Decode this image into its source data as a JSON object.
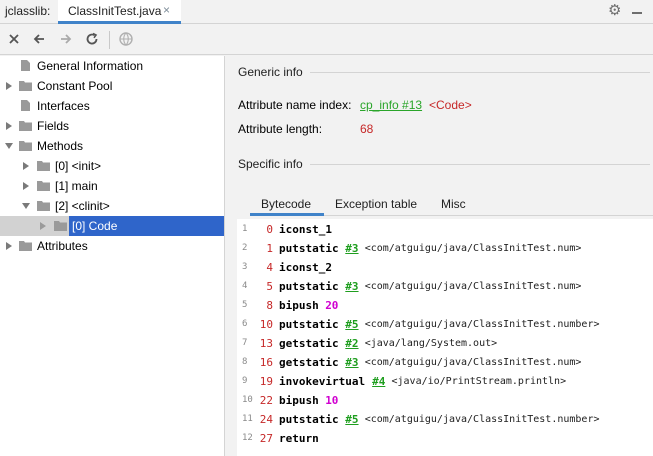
{
  "titlebar": {
    "app_label": "jclasslib:",
    "tab_label": "ClassInitTest.java",
    "tab_close": "×"
  },
  "toolbar": {
    "buttons": [
      "close-icon",
      "back-icon",
      "forward-icon",
      "refresh-icon",
      "web-icon"
    ]
  },
  "tree": {
    "items": [
      {
        "label": "General Information",
        "icon": "file-icon"
      },
      {
        "label": "Constant Pool",
        "icon": "folder-icon"
      },
      {
        "label": "Interfaces",
        "icon": "file-icon"
      },
      {
        "label": "Fields",
        "icon": "folder-icon"
      },
      {
        "label": "Methods",
        "icon": "folder-icon"
      },
      {
        "label": "[0] <init>",
        "icon": "folder-icon"
      },
      {
        "label": "[1] main",
        "icon": "folder-icon"
      },
      {
        "label": "[2] <clinit>",
        "icon": "folder-icon"
      },
      {
        "label": "[0] Code",
        "icon": "folder-icon",
        "selected": true
      },
      {
        "label": "Attributes",
        "icon": "folder-icon"
      }
    ]
  },
  "generic": {
    "title": "Generic info",
    "name_index_label": "Attribute name index:",
    "name_index_link": "cp_info #13",
    "name_index_value": "<Code>",
    "length_label": "Attribute length:",
    "length_value": "68"
  },
  "specific": {
    "title": "Specific info",
    "tabs": [
      "Bytecode",
      "Exception table",
      "Misc"
    ]
  },
  "bytecode": [
    {
      "line": "1",
      "offset": "0",
      "op": "iconst_1"
    },
    {
      "line": "2",
      "offset": "1",
      "op": "putstatic",
      "cp": "#3",
      "ref": "<com/atguigu/java/ClassInitTest.num>"
    },
    {
      "line": "3",
      "offset": "4",
      "op": "iconst_2"
    },
    {
      "line": "4",
      "offset": "5",
      "op": "putstatic",
      "cp": "#3",
      "ref": "<com/atguigu/java/ClassInitTest.num>"
    },
    {
      "line": "5",
      "offset": "8",
      "op": "bipush",
      "num": "20"
    },
    {
      "line": "6",
      "offset": "10",
      "op": "putstatic",
      "cp": "#5",
      "ref": "<com/atguigu/java/ClassInitTest.number>"
    },
    {
      "line": "7",
      "offset": "13",
      "op": "getstatic",
      "cp": "#2",
      "ref": "<java/lang/System.out>"
    },
    {
      "line": "8",
      "offset": "16",
      "op": "getstatic",
      "cp": "#3",
      "ref": "<com/atguigu/java/ClassInitTest.num>"
    },
    {
      "line": "9",
      "offset": "19",
      "op": "invokevirtual",
      "cp": "#4",
      "ref": "<java/io/PrintStream.println>"
    },
    {
      "line": "10",
      "offset": "22",
      "op": "bipush",
      "num": "10"
    },
    {
      "line": "11",
      "offset": "24",
      "op": "putstatic",
      "cp": "#5",
      "ref": "<com/atguigu/java/ClassInitTest.number>"
    },
    {
      "line": "12",
      "offset": "27",
      "op": "return"
    }
  ],
  "colors": {
    "accent": "#4083c9",
    "selection": "#2f65ca",
    "link_green": "#2aa52a",
    "value_red": "#c62828",
    "number_magenta": "#d000d0"
  }
}
